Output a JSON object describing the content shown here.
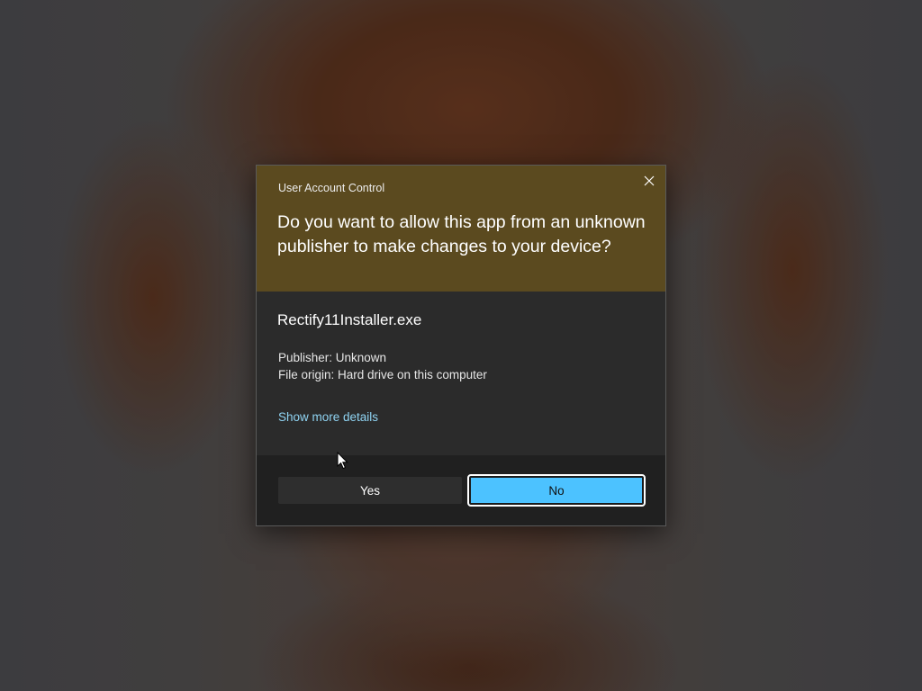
{
  "dialog": {
    "title": "User Account Control",
    "question": "Do you want to allow this app from an unknown publisher to make changes to your device?",
    "app_name": "Rectify11Installer.exe",
    "publisher_line": "Publisher: Unknown",
    "origin_line": "File origin: Hard drive on this computer",
    "details_link": "Show more details",
    "buttons": {
      "yes": "Yes",
      "no": "No"
    },
    "close_icon": "close-icon"
  },
  "colors": {
    "header_background": "#5b4a1f",
    "body_background": "#2b2b2b",
    "footer_background": "#202020",
    "accent_button": "#4cc2ff",
    "link": "#8fd3f2"
  }
}
